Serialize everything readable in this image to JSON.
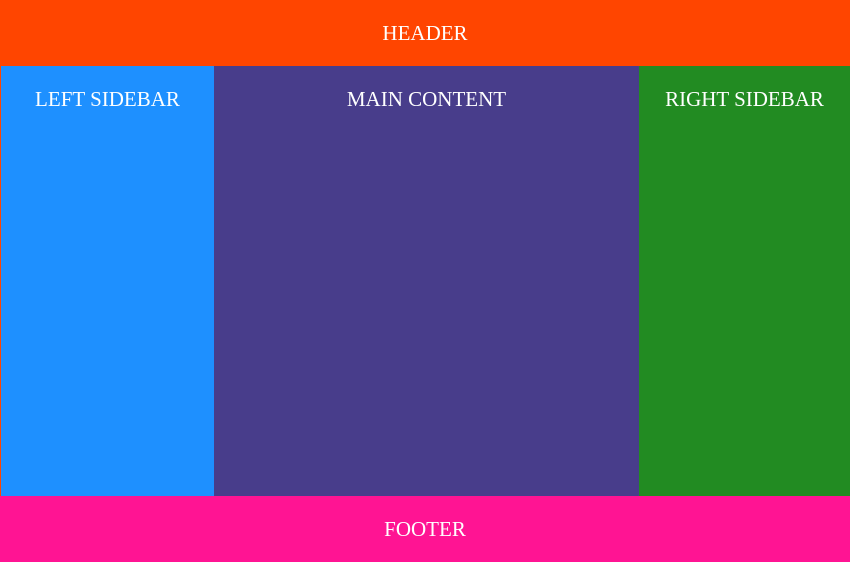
{
  "header": {
    "title": "HEADER",
    "background_color": "#ff4500"
  },
  "left_sidebar": {
    "title": "LEFT SIDEBAR",
    "background_color": "#1e90ff"
  },
  "main_content": {
    "title": "MAIN CONTENT",
    "background_color": "#483d8b"
  },
  "right_sidebar": {
    "title": "RIGHT SIDEBAR",
    "background_color": "#228b22"
  },
  "footer": {
    "title": "FOOTER",
    "background_color": "#ff1493"
  }
}
